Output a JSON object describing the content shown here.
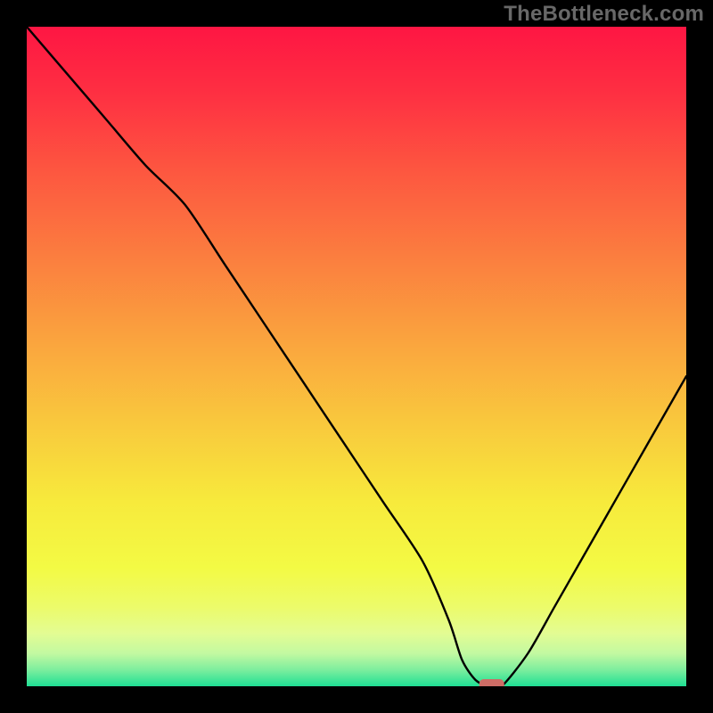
{
  "watermark": "TheBottleneck.com",
  "chart_data": {
    "type": "line",
    "title": "",
    "xlabel": "",
    "ylabel": "",
    "xlim": [
      0,
      100
    ],
    "ylim": [
      0,
      100
    ],
    "grid": false,
    "legend": false,
    "x": [
      0,
      6,
      12,
      18,
      24,
      30,
      36,
      42,
      48,
      54,
      60,
      64,
      66,
      68,
      70,
      72,
      76,
      80,
      84,
      88,
      92,
      96,
      100
    ],
    "values": [
      100,
      93,
      86,
      79,
      73,
      64,
      55,
      46,
      37,
      28,
      19,
      10,
      4,
      1,
      0,
      0,
      5,
      12,
      19,
      26,
      33,
      40,
      47
    ],
    "marker": {
      "x": 70.5,
      "y": 0,
      "color": "#cd6d66"
    },
    "background_gradient_stops": [
      {
        "offset": 0.0,
        "color": "#fe1643"
      },
      {
        "offset": 0.1,
        "color": "#fe2f42"
      },
      {
        "offset": 0.22,
        "color": "#fd5740"
      },
      {
        "offset": 0.35,
        "color": "#fb7e3f"
      },
      {
        "offset": 0.48,
        "color": "#faa53e"
      },
      {
        "offset": 0.6,
        "color": "#f9c83d"
      },
      {
        "offset": 0.72,
        "color": "#f7ea3c"
      },
      {
        "offset": 0.82,
        "color": "#f3fa44"
      },
      {
        "offset": 0.88,
        "color": "#ecfb6a"
      },
      {
        "offset": 0.92,
        "color": "#e3fc93"
      },
      {
        "offset": 0.95,
        "color": "#c3f9a1"
      },
      {
        "offset": 0.975,
        "color": "#7dee9e"
      },
      {
        "offset": 1.0,
        "color": "#1fdf94"
      }
    ]
  }
}
